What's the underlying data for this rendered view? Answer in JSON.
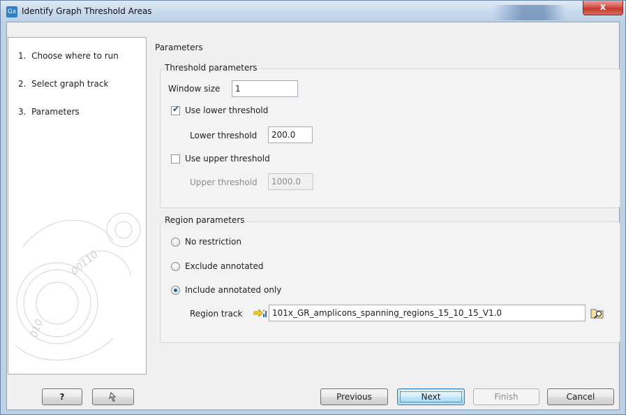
{
  "window": {
    "app_icon": "Gx",
    "title": "Identify Graph Threshold Areas",
    "close_label": "x"
  },
  "steps": [
    {
      "number": "1.",
      "label": "Choose where to run"
    },
    {
      "number": "2.",
      "label": "Select graph track"
    },
    {
      "number": "3.",
      "label": "Parameters"
    }
  ],
  "params": {
    "header": "Parameters",
    "threshold": {
      "title": "Threshold parameters",
      "window_size_label": "Window size",
      "window_size_value": "1",
      "use_lower_label": "Use lower threshold",
      "use_lower_checked": true,
      "lower_label": "Lower threshold",
      "lower_value": "200.0",
      "use_upper_label": "Use upper threshold",
      "use_upper_checked": false,
      "upper_label": "Upper threshold",
      "upper_value": "1000.0"
    },
    "region": {
      "title": "Region parameters",
      "options": [
        "No restriction",
        "Exclude annotated",
        "Include annotated only"
      ],
      "selected": "Include annotated only",
      "track_label": "Region track",
      "track_value": "101x_GR_amplicons_spanning_regions_15_10_15_V1.0"
    }
  },
  "buttons": {
    "help": "?",
    "previous": "Previous",
    "next": "Next",
    "finish": "Finish",
    "cancel": "Cancel"
  },
  "icons": {
    "app": "gx-app-icon",
    "help": "help-icon",
    "reset": "reset-icon",
    "track": "annotation-track-icon",
    "browse": "browse-folder-icon"
  }
}
